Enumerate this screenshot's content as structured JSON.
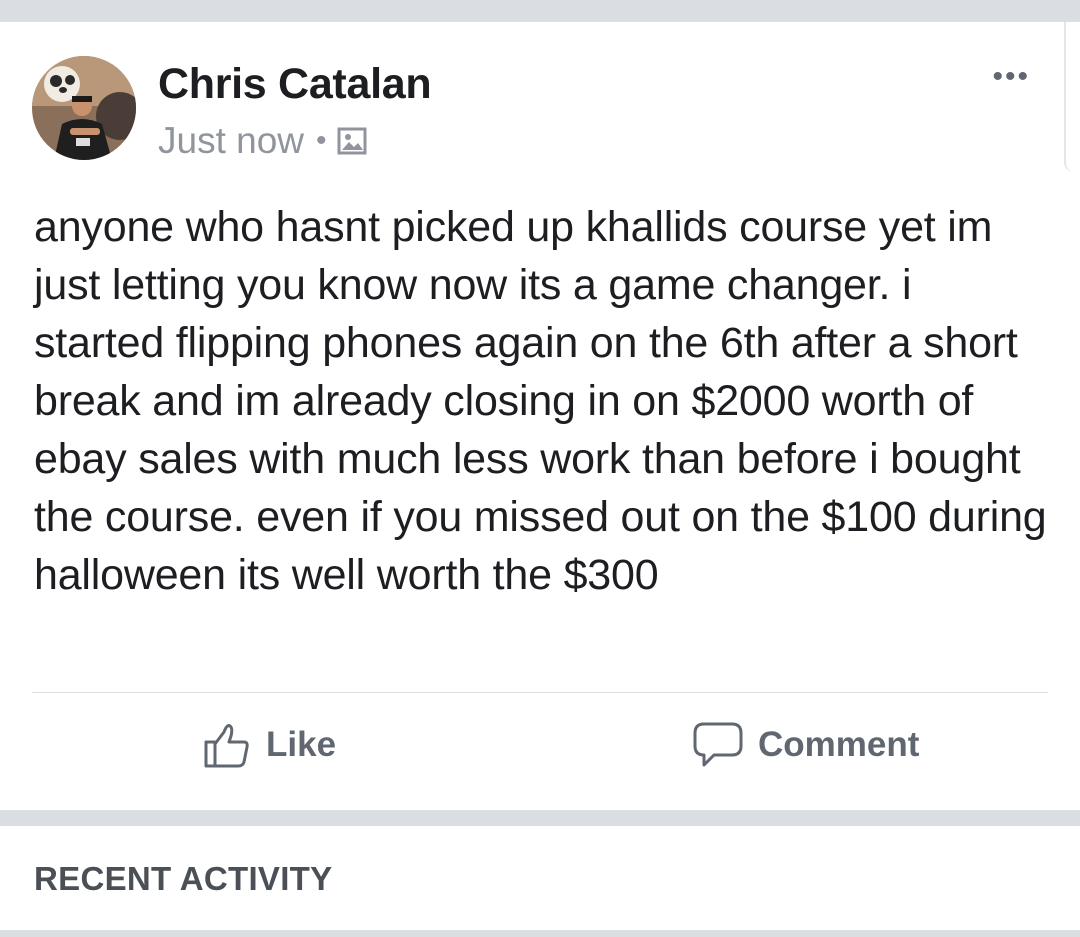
{
  "post": {
    "author": "Chris Catalan",
    "timestamp": "Just now",
    "separator": "•",
    "privacy_icon": "photo-icon",
    "more_icon": "more-options-icon",
    "more_label": "•••",
    "body": "anyone who hasnt picked up khallids course yet im just letting you know now its a game changer. i started flipping phones again on the 6th after a short break and im already closing in on $2000 worth of ebay sales with much less work than before i bought the course. even if you missed out on the $100 during halloween its well worth the $300"
  },
  "actions": {
    "like_label": "Like",
    "comment_label": "Comment"
  },
  "recent_activity": {
    "title": "RECENT ACTIVITY"
  },
  "colors": {
    "background": "#dadde1",
    "card": "#ffffff",
    "text": "#1c1e21",
    "secondary_text": "#90949c",
    "action_text": "#606770"
  }
}
